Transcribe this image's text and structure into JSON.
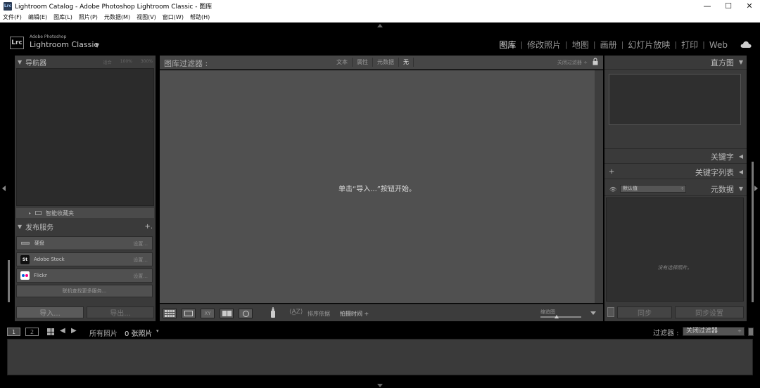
{
  "titlebar": {
    "app_icon": "Lrc",
    "title": "Lightroom Catalog - Adobe Photoshop Lightroom Classic - 图库",
    "minimize": "—",
    "maximize": "☐",
    "close": "✕"
  },
  "menu": [
    "文件(F)",
    "编辑(E)",
    "图库(L)",
    "照片(P)",
    "元数据(M)",
    "视图(V)",
    "窗口(W)",
    "帮助(H)"
  ],
  "header": {
    "logo": "Lrc",
    "brand_sub": "Adobe Photoshop",
    "brand_main": "Lightroom Classic",
    "brand_caret": "▼",
    "modules": [
      {
        "label": "图库",
        "active": true
      },
      {
        "label": "修改照片"
      },
      {
        "label": "地图"
      },
      {
        "label": "画册"
      },
      {
        "label": "幻灯片放映"
      },
      {
        "label": "打印"
      },
      {
        "label": "Web"
      }
    ],
    "separator": "|"
  },
  "left_panel": {
    "navigator": {
      "title": "导航器",
      "zoom_options": [
        "适合",
        "100%",
        "300%"
      ]
    },
    "collections": {
      "label": "智能收藏夹",
      "caret": "▸"
    },
    "publish": {
      "title": "发布服务",
      "plus": "+.",
      "services": [
        {
          "name": "硬盘",
          "setup": "设置..."
        },
        {
          "name": "Adobe Stock",
          "icon": "St",
          "setup": "设置..."
        },
        {
          "name": "Flickr",
          "setup": "设置..."
        }
      ],
      "find_more": "联机查找更多服务..."
    },
    "import_label": "导入...",
    "export_label": "导出..."
  },
  "filter_bar": {
    "title": "图库过滤器 :",
    "tabs": [
      {
        "label": "文本"
      },
      {
        "label": "属性"
      },
      {
        "label": "元数据"
      },
      {
        "label": "无",
        "active": true
      }
    ],
    "close_filters": "关闭过滤器 ÷"
  },
  "grid": {
    "empty_message": "单击“导入...”按钮开始。"
  },
  "toolbar": {
    "xy_label": "XY",
    "sort_icon": "⟨A̲Z⟩",
    "sort_label": "排序依据",
    "sort_value": "拍摄时间 ÷",
    "thumbnail_label": "缩览图"
  },
  "right_panel": {
    "histogram": "直方图",
    "keywording": "关键字",
    "keyword_list": "关键字列表",
    "keyword_plus": "+",
    "metadata": "元数据",
    "metadata_preset": "默认值",
    "metadata_empty": "没有选择照片。",
    "eye_icon": "👁",
    "sync_label": "同步",
    "sync_settings_label": "同步设置"
  },
  "filmstrip": {
    "page1": "1",
    "page2": "2",
    "back": "◀",
    "forward": "▶",
    "source": "所有照片",
    "count": "0 张照片",
    "caret": "▾",
    "filter_label": "过滤器 :",
    "filter_value": "关闭过滤器"
  },
  "colors": {
    "flickr_blue": "#0063dc",
    "flickr_pink": "#ff0084",
    "panel_bg": "#3a3a3a",
    "grid_bg": "#505050"
  }
}
